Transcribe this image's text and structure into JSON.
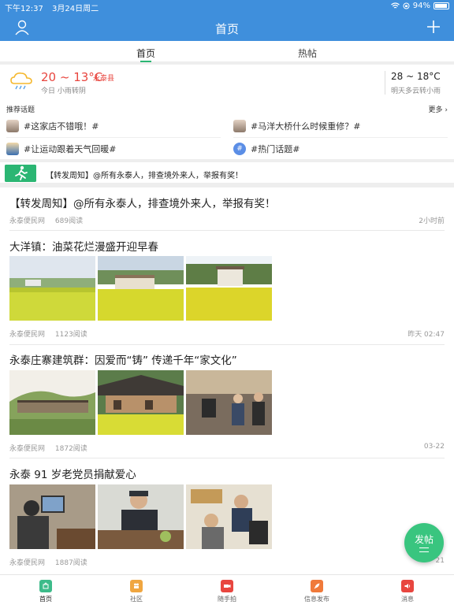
{
  "status_bar": {
    "time": "下午12:37",
    "date": "3月24日周二",
    "battery": "94%"
  },
  "header": {
    "title": "首页"
  },
  "tabs": [
    {
      "label": "首页"
    },
    {
      "label": "热帖"
    }
  ],
  "weather": {
    "today_temp": "20 ~ 13°C",
    "location": "永泰县",
    "today_desc": "今日 小雨转阴",
    "tomorrow_temp": "28 ~ 18°C",
    "tomorrow_desc": "明天多云转小雨"
  },
  "topics": {
    "title": "推荐话题",
    "more": "更多",
    "items": [
      {
        "label": "#这家店不错哦！#"
      },
      {
        "label": "#马洋大桥什么时候重修？#"
      },
      {
        "label": "#让运动跟着天气回暖#"
      },
      {
        "label": "#热门话题#"
      }
    ]
  },
  "banner": {
    "text": "【转发周知】@所有永泰人，排查境外来人，举报有奖！"
  },
  "posts": [
    {
      "title": "【转发周知】@所有永泰人，排查境外来人，举报有奖！",
      "source": "永泰便民网",
      "reads": "689阅读",
      "time": "2小时前"
    },
    {
      "title": "大洋镇：油菜花烂漫盛开迎早春",
      "source": "永泰便民网",
      "reads": "1123阅读",
      "time": "昨天 02:47"
    },
    {
      "title": "永泰庄寨建筑群：因爱而“铸” 传递千年“家文化”",
      "source": "永泰便民网",
      "reads": "1872阅读",
      "time": "03-22"
    },
    {
      "title": "永泰 91 岁老党员捐献爱心",
      "source": "永泰便民网",
      "reads": "1887阅读",
      "time": "21"
    }
  ],
  "fab": {
    "label": "发帖"
  },
  "bottom_nav": [
    {
      "label": "首页",
      "color": "#3dbb8a"
    },
    {
      "label": "社区",
      "color": "#f0a640"
    },
    {
      "label": "随手拍",
      "color": "#e8463f"
    },
    {
      "label": "信息发布",
      "color": "#f07a3a"
    },
    {
      "label": "消息",
      "color": "#e8463f"
    }
  ],
  "colors": {
    "header_bg": "#3f8fdc",
    "accent_green": "#2bb673",
    "temp_red": "#e8463f"
  }
}
